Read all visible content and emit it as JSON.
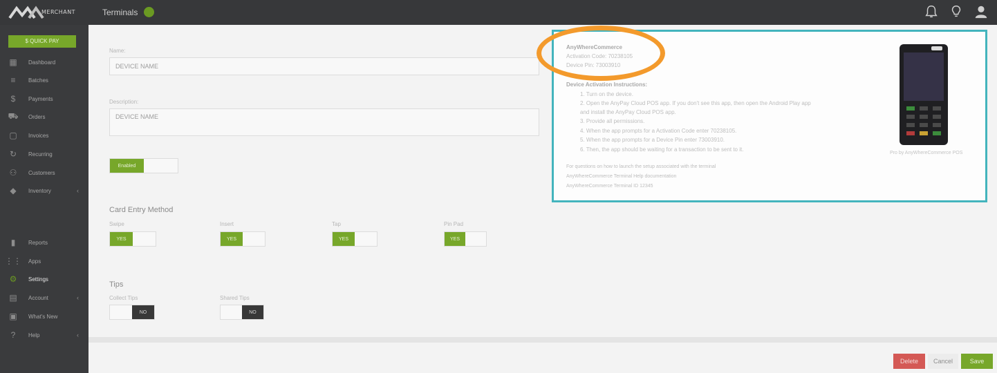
{
  "app": {
    "logo_text": "MERCHANT",
    "page_title": "Terminals"
  },
  "sidebar": {
    "quick_pay_label": "$ QUICK PAY",
    "items": [
      {
        "label": "Dashboard",
        "icon": "dashboard-icon"
      },
      {
        "label": "Batches",
        "icon": "list-icon"
      },
      {
        "label": "Payments",
        "icon": "dollar-icon"
      },
      {
        "label": "Orders",
        "icon": "cart-icon"
      },
      {
        "label": "Invoices",
        "icon": "clipboard-icon"
      },
      {
        "label": "Recurring",
        "icon": "refresh-icon"
      },
      {
        "label": "Customers",
        "icon": "users-icon"
      },
      {
        "label": "Inventory",
        "icon": "tag-icon"
      },
      {
        "label": "Reports",
        "icon": "bar-chart-icon"
      },
      {
        "label": "Apps",
        "icon": "grid-icon"
      },
      {
        "label": "Settings",
        "icon": "gear-icon"
      },
      {
        "label": "Account",
        "icon": "store-icon"
      },
      {
        "label": "What's New",
        "icon": "gift-icon"
      },
      {
        "label": "Help",
        "icon": "help-icon"
      }
    ]
  },
  "form": {
    "name_label": "Name:",
    "name_value": "DEVICE NAME",
    "description_label": "Description:",
    "description_value": "DEVICE NAME",
    "enabled_toggle": "Enabled",
    "card_entry_title": "Card Entry Method",
    "swipe_label": "Swipe",
    "swipe_toggle": "YES",
    "insert_label": "Insert",
    "insert_toggle": "YES",
    "tap_label": "Tap",
    "tap_toggle": "YES",
    "pin_pad_label": "Pin Pad",
    "pin_pad_toggle": "YES",
    "tips_title": "Tips",
    "collect_tips_label": "Collect Tips",
    "collect_tips_toggle": "NO",
    "shared_tips_label": "Shared Tips",
    "shared_tips_toggle": "NO"
  },
  "actions": {
    "delete_label": "Delete",
    "cancel_label": "Cancel",
    "save_label": "Save"
  },
  "popup": {
    "title": "AnyWhereCommerce",
    "activation_code": "Activation Code: 70238105",
    "device_pin": "Device Pin: 73003910",
    "instructions_title": "Device Activation Instructions:",
    "steps": [
      "1. Turn on the device.",
      "2. Open the AnyPay Cloud POS app. If you don't see this app, then open the Android Play app",
      "   and install the AnyPay Cloud POS app.",
      "3. Provide all permissions.",
      "4. When the app prompts for a Activation Code enter 70238105.",
      "5. When the app prompts for a Device Pin enter 73003910.",
      "6. Then, the app should be waiting for a transaction to be sent to it."
    ],
    "footer_lines": [
      "For questions on how to launch the setup associated with the terminal",
      "AnyWhereCommerce Terminal Help documentation",
      "AnyWhereCommerce Terminal ID 12345"
    ],
    "device_caption": "Pro by AnyWhereCommerce POS"
  },
  "colors": {
    "accent_green": "#77a72a",
    "popup_border": "#43b4bd",
    "highlight_ring": "#f39a2c",
    "delete_red": "#d45955",
    "sidebar_bg": "#3a3b3d"
  }
}
